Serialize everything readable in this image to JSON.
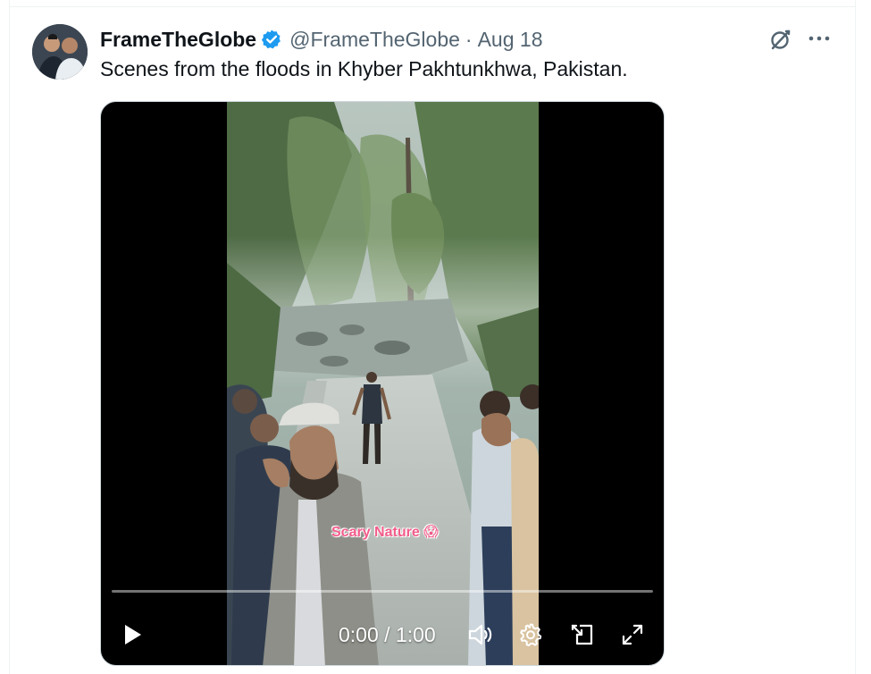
{
  "tweet": {
    "author": {
      "display_name": "FrameTheGlobe",
      "handle": "@FrameTheGlobe",
      "verified": true
    },
    "separator": "·",
    "timestamp": "Aug 18",
    "text": "Scenes from the floods in Khyber Pakhtunkhwa, Pakistan."
  },
  "video": {
    "overlay_caption": "Scary Nature 😱",
    "current_time": "0:00",
    "time_separator": " / ",
    "duration": "1:00",
    "progress": 0,
    "controls": [
      "play-icon",
      "volume-icon",
      "settings-gear-icon",
      "picture-in-picture-icon",
      "fullscreen-icon"
    ]
  },
  "colors": {
    "text_primary": "#0f1419",
    "text_secondary": "#536471",
    "verified_blue": "#1d9bf0",
    "caption_pink": "#f25c8a"
  }
}
